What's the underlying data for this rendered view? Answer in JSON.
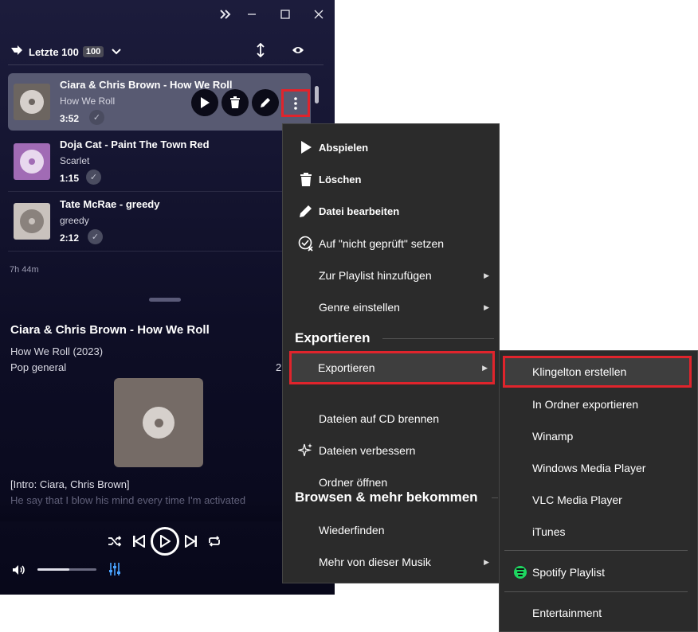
{
  "window": {
    "controls": [
      "expand-icon",
      "minimize-icon",
      "maximize-icon",
      "close-icon"
    ]
  },
  "library": {
    "title": "Letzte 100",
    "badge": "100",
    "total_duration": "7h 44m"
  },
  "tracks": [
    {
      "title": "Ciara & Chris Brown - How We Roll",
      "album": "How We Roll",
      "duration": "3:52",
      "cover_color": "#6c6560",
      "disc_color": "#d6d0cc"
    },
    {
      "title": "Doja Cat - Paint The Town Red",
      "album": "Scarlet",
      "duration": "1:15",
      "cover_color": "#a16bb5",
      "disc_color": "#e8d8ee"
    },
    {
      "title": "Tate McRae - greedy",
      "album": "greedy",
      "duration": "2:12",
      "cover_color": "#c9c2bd",
      "disc_color": "#8a827d"
    }
  ],
  "now_playing": {
    "title": "Ciara & Chris Brown - How We Roll",
    "album_year": "How We Roll (2023)",
    "genre": "Pop general",
    "clipped_value": "2",
    "lyric_line_1": "[Intro: Ciara, Chris Brown]",
    "lyric_line_2": "He say that I blow his mind every time I'm activated",
    "volume_level": 0.54
  },
  "context_menu": {
    "items": [
      {
        "label": "Abspielen",
        "icon": "play-icon",
        "bold": true
      },
      {
        "label": "Löschen",
        "icon": "trash-icon",
        "bold": true
      },
      {
        "label": "Datei bearbeiten",
        "icon": "pencil-icon",
        "bold": true
      },
      {
        "label": "Auf \"nicht geprüft\" setzen",
        "icon": "uncheck-icon",
        "bold": false
      },
      {
        "label": "Zur Playlist hinzufügen",
        "icon": "",
        "submenu": true
      },
      {
        "label": "Genre einstellen",
        "icon": "",
        "submenu": true
      }
    ],
    "section_export": "Exportieren",
    "export_items": [
      {
        "label": "Exportieren",
        "submenu": true
      },
      {
        "label": "Dateien auf CD brennen"
      },
      {
        "label": "Dateien verbessern",
        "icon": "sparkle-icon"
      },
      {
        "label": "Ordner öffnen"
      }
    ],
    "section_browse": "Browsen & mehr bekommen",
    "browse_items": [
      {
        "label": "Wiederfinden"
      },
      {
        "label": "Mehr von dieser Musik",
        "submenu": true
      }
    ]
  },
  "export_submenu": {
    "items": [
      "Klingelton erstellen",
      "In Ordner exportieren",
      "Winamp",
      "Windows Media Player",
      "VLC Media Player",
      "iTunes"
    ],
    "spotify": "Spotify Playlist",
    "entertainment": "Entertainment"
  },
  "colors": {
    "highlight_border": "#e0242c",
    "menu_bg": "#2b2b2b",
    "app_bg": "#14142e"
  }
}
